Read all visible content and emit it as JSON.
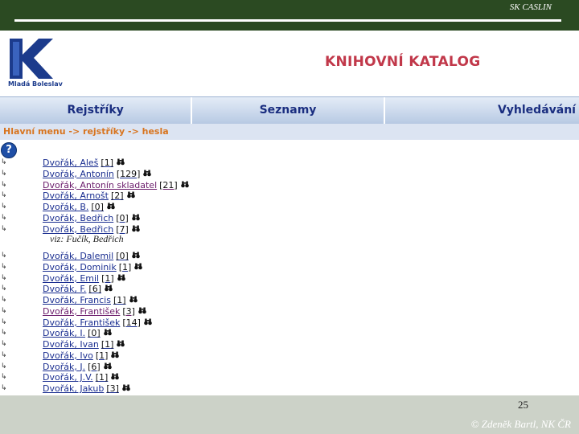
{
  "slide": {
    "org": "SK CASLIN",
    "page_number": "25",
    "copyright": "© Zdeněk Bartl, NK ČR"
  },
  "logo": {
    "letter": "K",
    "place": "Mladá Boleslav",
    "brand_color": "#1c3b8c"
  },
  "header": {
    "title": "KNIHOVNÍ KATALOG"
  },
  "tabs": [
    {
      "label": "Rejstříky"
    },
    {
      "label": "Seznamy"
    },
    {
      "label": "Vyhledávání"
    }
  ],
  "breadcrumb": "Hlavní menu -> rejstříky -> hesla",
  "help": {
    "symbol": "?"
  },
  "entries": [
    {
      "name": "Dvořák, Aleš",
      "count": "[1]"
    },
    {
      "name": "Dvořák, Antonín",
      "count": "[129]"
    },
    {
      "name": "Dvořák, Antonín skladatel",
      "count": "[21]"
    },
    {
      "name": "Dvořák, Arnošt",
      "count": "[2]"
    },
    {
      "name": "Dvořák, B.",
      "count": "[0]"
    },
    {
      "name": "Dvořák, Bedřich",
      "count": "[0]"
    },
    {
      "name": "Dvořák, Bedřich",
      "count": "[7]"
    },
    {
      "see": "viz: Fučík, Bedřich"
    },
    {
      "name": "Dvořák, Dalemil",
      "count": "[0]"
    },
    {
      "name": "Dvořák, Dominik",
      "count": "[1]"
    },
    {
      "name": "Dvořák, Emil",
      "count": "[1]"
    },
    {
      "name": "Dvořák, F.",
      "count": "[6]"
    },
    {
      "name": "Dvořák, Francis",
      "count": "[1]"
    },
    {
      "name": "Dvořák, František",
      "count": "[3]"
    },
    {
      "name": "Dvořák, František",
      "count": "[14]"
    },
    {
      "name": "Dvořák, I.",
      "count": "[0]"
    },
    {
      "name": "Dvořák, Ivan",
      "count": "[1]"
    },
    {
      "name": "Dvořák, Ivo",
      "count": "[1]"
    },
    {
      "name": "Dvořák, J.",
      "count": "[6]"
    },
    {
      "name": "Dvořák, J.V.",
      "count": "[1]"
    },
    {
      "name": "Dvořák, Jakub",
      "count": "[3]"
    }
  ],
  "visited_entries": [
    2,
    13
  ],
  "icons": {
    "bullet": "arrow-bullet-icon",
    "search": "binoculars-icon"
  }
}
